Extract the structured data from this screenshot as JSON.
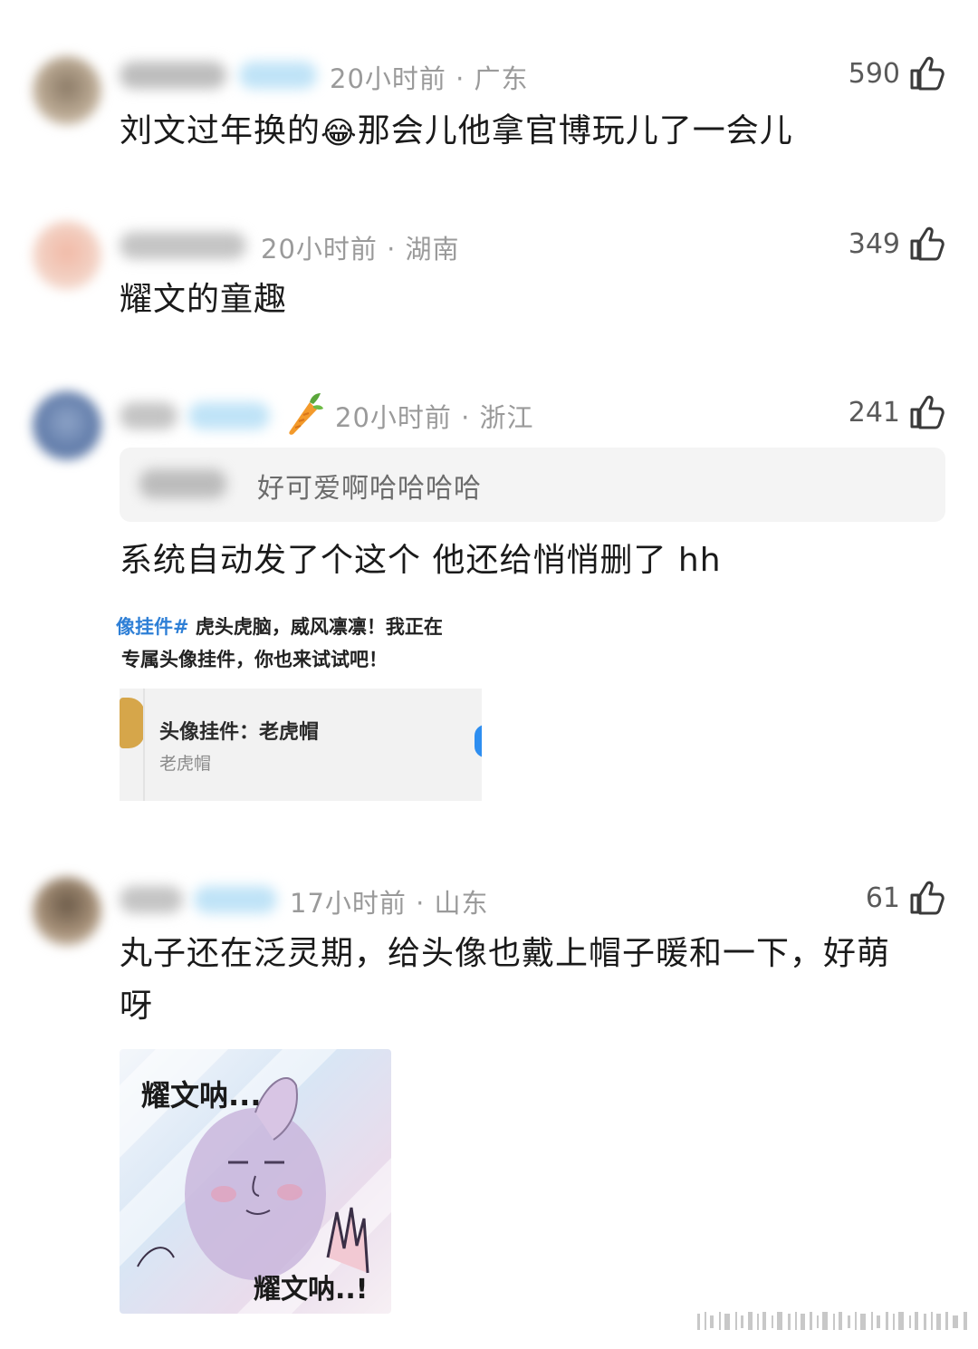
{
  "comments": [
    {
      "meta": "20小时前 · 广东",
      "likes": "590",
      "text_before": "刘文过年换的",
      "emoji": "😂",
      "text_after": "那会儿他拿官博玩儿了一会儿"
    },
    {
      "meta": "20小时前 · 湖南",
      "likes": "349",
      "text": "耀文的童趣"
    },
    {
      "meta": "20小时前 · 浙江",
      "likes": "241",
      "badge_icon": "carrot-icon",
      "quote": "好可爱啊哈哈哈哈",
      "text": "系统自动发了个这个 他还给悄悄删了 hh",
      "screenshot": {
        "line1_tag": "像挂件#",
        "line1_rest": " 虎头虎脑，威风凛凛！我正在",
        "line2": "专属头像挂件，你也来试试吧！",
        "card_title": "头像挂件：老虎帽",
        "card_sub": "老虎帽"
      }
    },
    {
      "meta": "17小时前 · 山东",
      "likes": "61",
      "text_line1": "丸子还在泛灵期，给头像也戴上帽子暖和一下，好萌",
      "text_line2": "呀",
      "meme": {
        "top": "耀文呐...",
        "bottom": "耀文呐..!"
      }
    }
  ],
  "colors": {
    "meta_gray": "#9a9a9a",
    "quote_bg": "#f4f4f4",
    "link_blue": "#2e7fd6"
  }
}
